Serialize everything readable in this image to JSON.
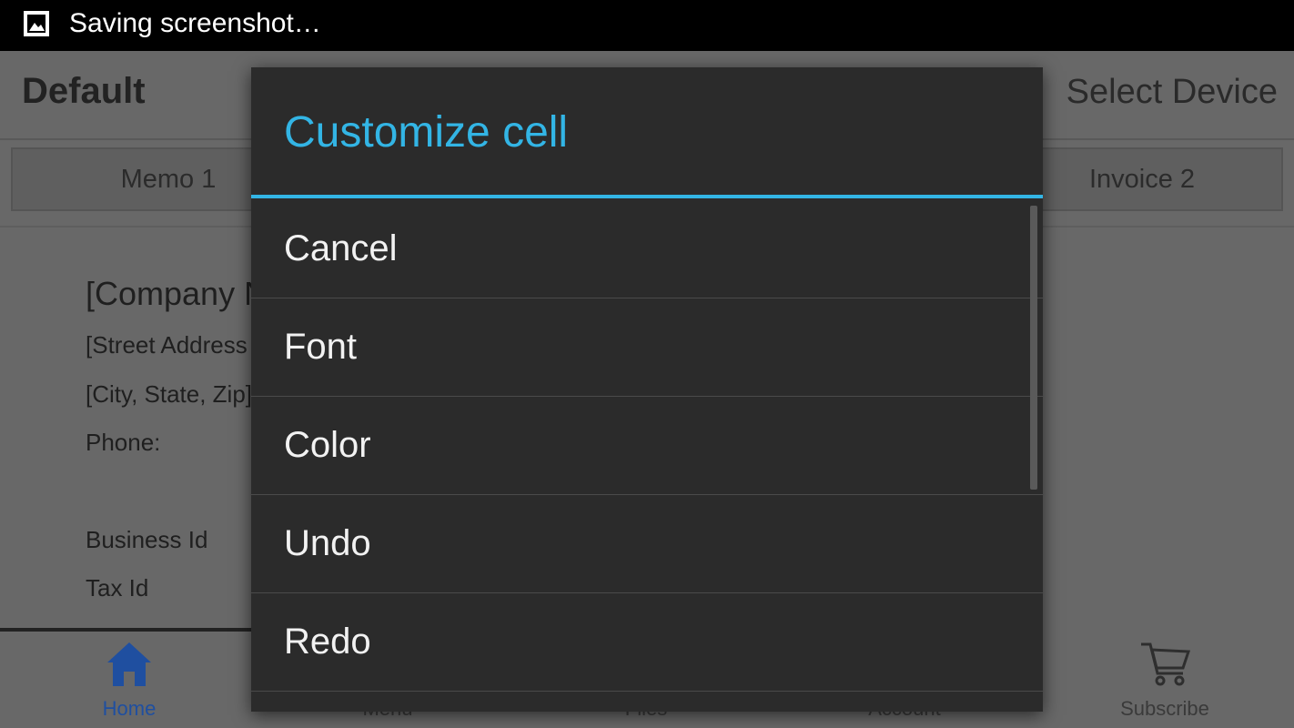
{
  "status_bar": {
    "notification_icon": "image-icon",
    "text": "Saving screenshot…"
  },
  "app": {
    "title": "Default",
    "select_device": "Select Device",
    "tabs": [
      {
        "label": "Memo 1"
      },
      {
        "label": "Invoice 2"
      }
    ],
    "document": {
      "company": "[Company N",
      "street": "[Street Address",
      "city": "[City, State, Zip]",
      "phone": "Phone:",
      "business_id": "Business Id",
      "tax_id": "Tax Id"
    },
    "bottom_nav": [
      {
        "label": "Home",
        "icon": "home-icon",
        "active": true
      },
      {
        "label": "Menu",
        "icon": "menu-icon"
      },
      {
        "label": "Files",
        "icon": "files-icon"
      },
      {
        "label": "Account",
        "icon": "account-icon"
      },
      {
        "label": "Subscribe",
        "icon": "cart-icon"
      }
    ]
  },
  "dialog": {
    "title": "Customize cell",
    "items": [
      {
        "label": "Cancel"
      },
      {
        "label": "Font"
      },
      {
        "label": "Color"
      },
      {
        "label": "Undo"
      },
      {
        "label": "Redo"
      }
    ]
  },
  "colors": {
    "accent": "#33b5e5",
    "dialog_bg": "#2b2b2b",
    "home_active": "#1f4fa0"
  }
}
